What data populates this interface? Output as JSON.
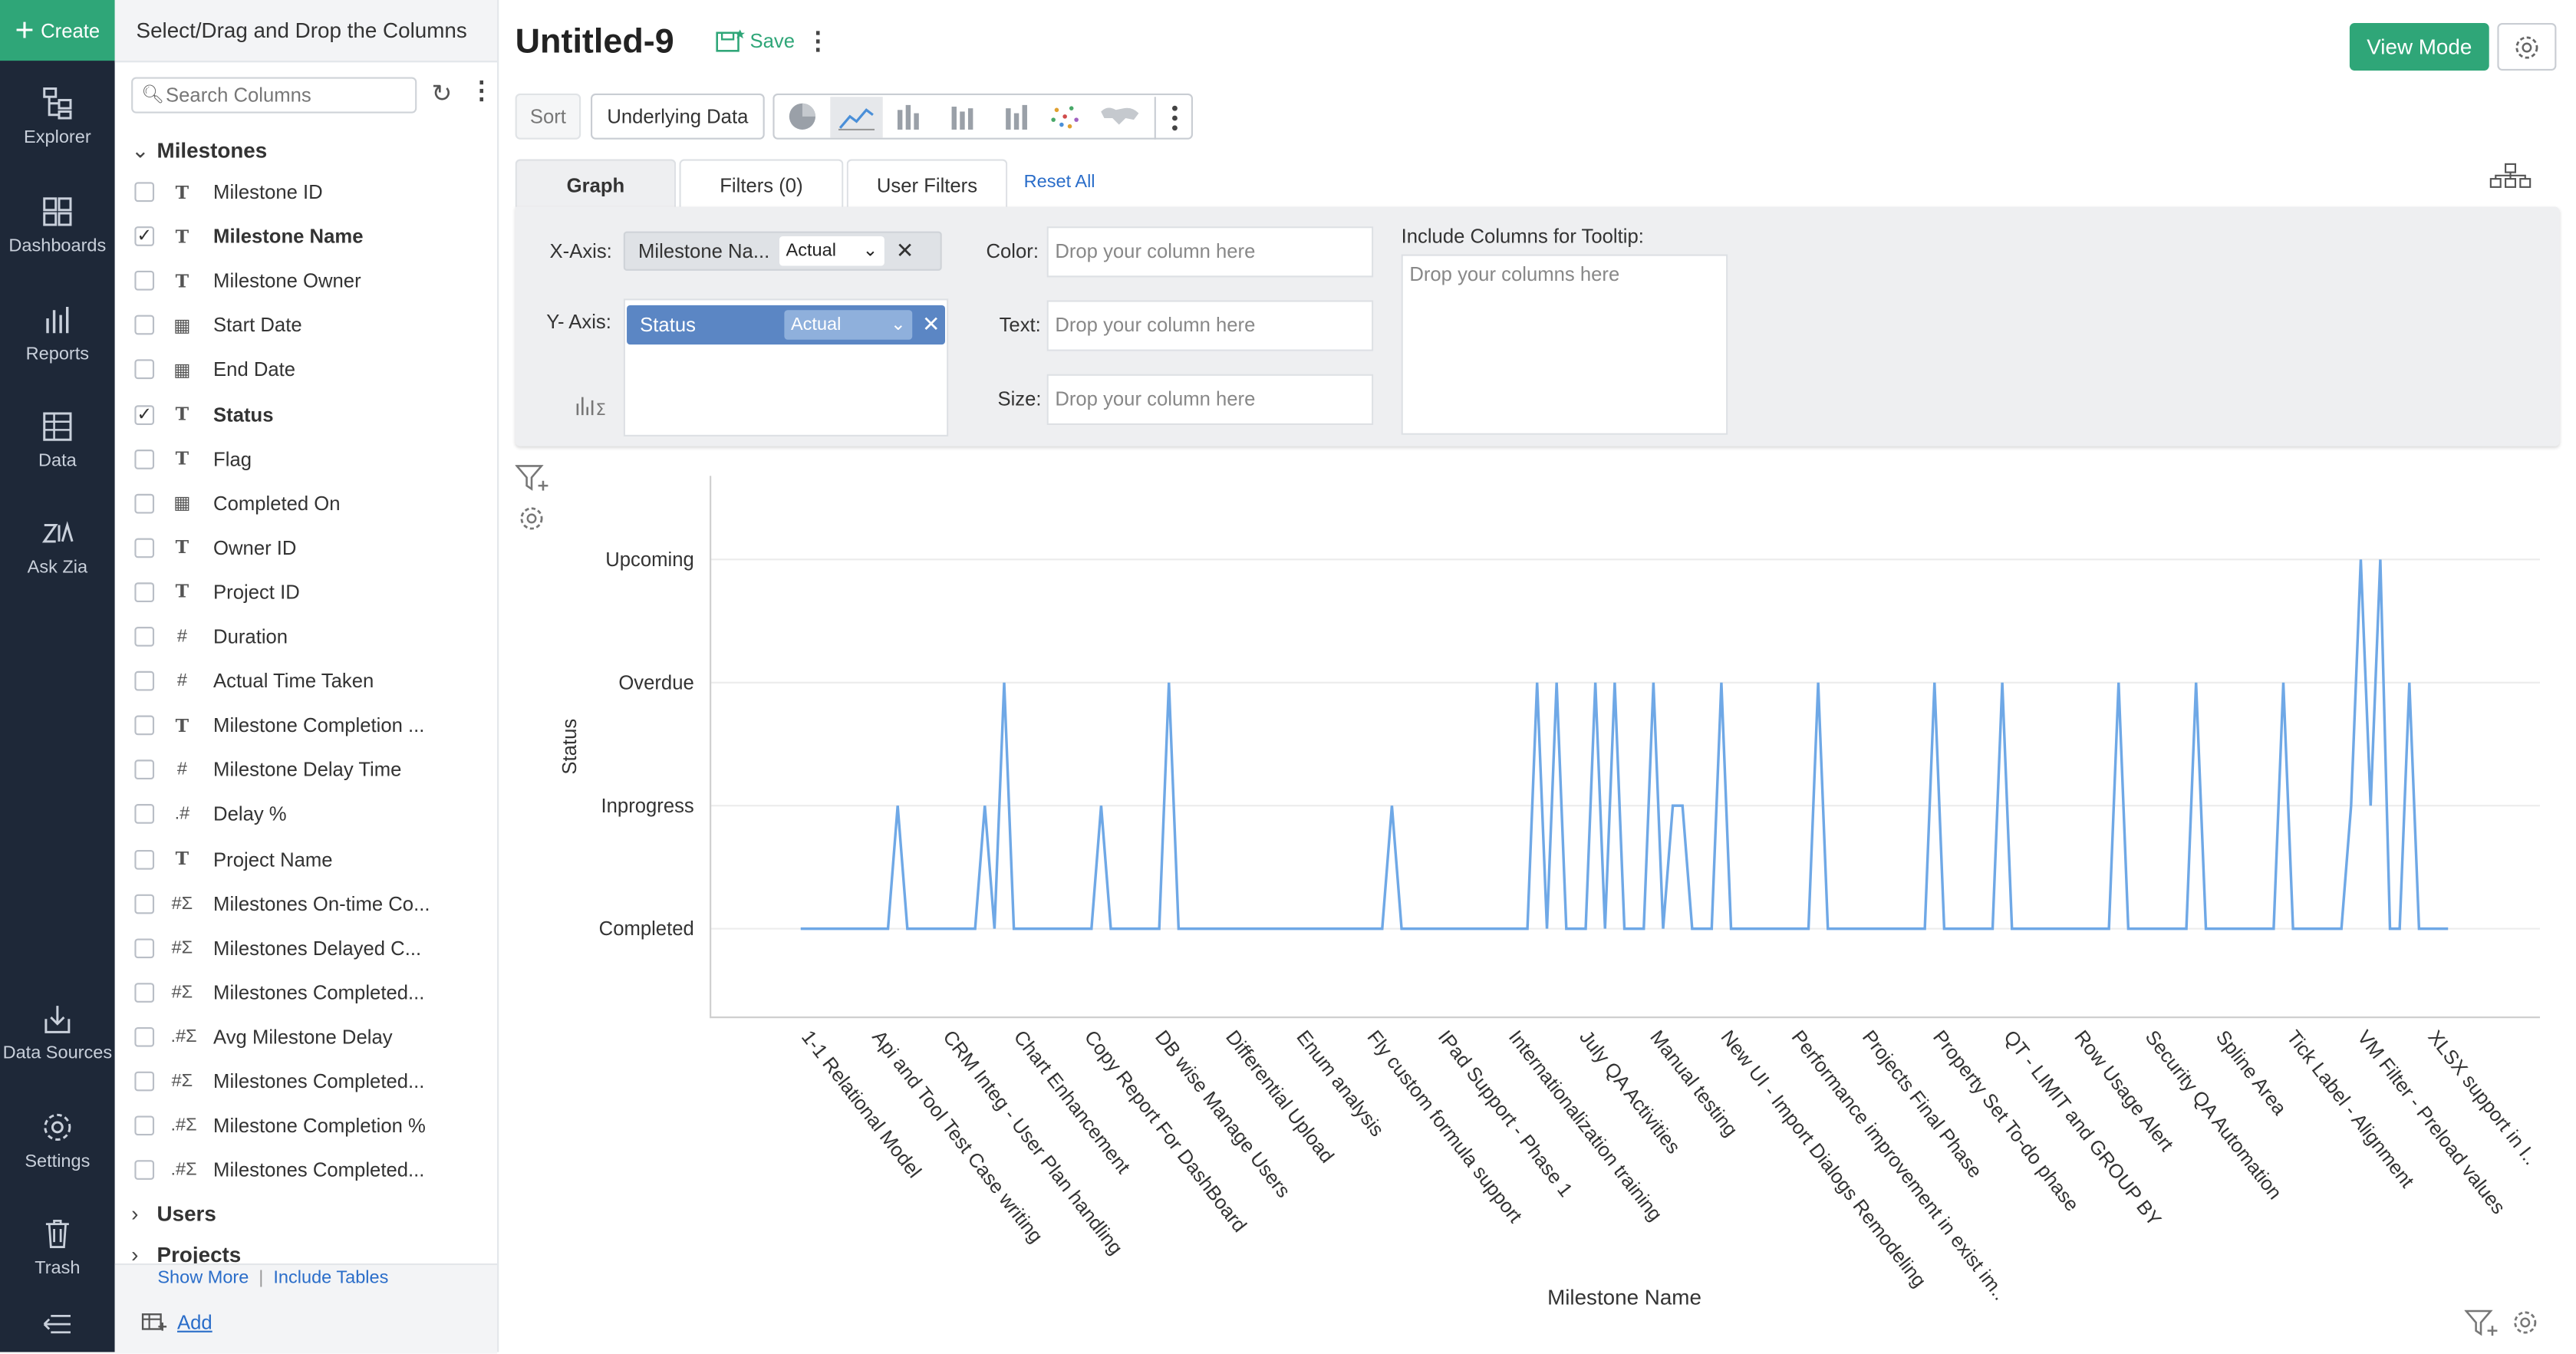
{
  "nav": {
    "create": "Create",
    "items": [
      {
        "label": "Explorer",
        "icon": "explorer-icon"
      },
      {
        "label": "Dashboards",
        "icon": "dashboards-icon"
      },
      {
        "label": "Reports",
        "icon": "reports-icon"
      },
      {
        "label": "Data",
        "icon": "data-icon"
      },
      {
        "label": "Ask Zia",
        "icon": "zia-icon"
      },
      {
        "label": "Data Sources",
        "icon": "data-sources-icon"
      },
      {
        "label": "Settings",
        "icon": "settings-icon"
      },
      {
        "label": "Trash",
        "icon": "trash-icon"
      }
    ]
  },
  "panel": {
    "header": "Select/Drag and Drop the Columns",
    "search_placeholder": "Search Columns",
    "group": "Milestones",
    "columns": [
      {
        "label": "Milestone ID",
        "type": "T",
        "checked": false
      },
      {
        "label": "Milestone Name",
        "type": "T",
        "checked": true
      },
      {
        "label": "Milestone Owner",
        "type": "T",
        "checked": false
      },
      {
        "label": "Start Date",
        "type": "date",
        "checked": false
      },
      {
        "label": "End Date",
        "type": "date",
        "checked": false
      },
      {
        "label": "Status",
        "type": "T",
        "checked": true
      },
      {
        "label": "Flag",
        "type": "T",
        "checked": false
      },
      {
        "label": "Completed On",
        "type": "date",
        "checked": false
      },
      {
        "label": "Owner ID",
        "type": "T",
        "checked": false
      },
      {
        "label": "Project ID",
        "type": "T",
        "checked": false
      },
      {
        "label": "Duration",
        "type": "#",
        "checked": false
      },
      {
        "label": "Actual Time Taken",
        "type": "#",
        "checked": false
      },
      {
        "label": "Milestone Completion ...",
        "type": "T",
        "checked": false
      },
      {
        "label": "Milestone Delay Time",
        "type": "#",
        "checked": false
      },
      {
        "label": "Delay %",
        "type": ".#",
        "checked": false
      },
      {
        "label": "Project Name",
        "type": "T",
        "checked": false
      },
      {
        "label": "Milestones On-time Co...",
        "type": "#Σ",
        "checked": false
      },
      {
        "label": "Milestones Delayed C...",
        "type": "#Σ",
        "checked": false
      },
      {
        "label": "Milestones Completed...",
        "type": "#Σ",
        "checked": false
      },
      {
        "label": "Avg Milestone Delay",
        "type": ".#Σ",
        "checked": false
      },
      {
        "label": "Milestones Completed...",
        "type": "#Σ",
        "checked": false
      },
      {
        "label": "Milestone Completion %",
        "type": ".#Σ",
        "checked": false
      },
      {
        "label": "Milestones Completed...",
        "type": ".#Σ",
        "checked": false
      }
    ],
    "other_groups": [
      "Users",
      "Projects"
    ],
    "show_more": "Show More",
    "include_tables": "Include Tables",
    "add": "Add"
  },
  "header": {
    "title": "Untitled-9",
    "save": "Save",
    "view_mode": "View Mode"
  },
  "toolbar": {
    "sort": "Sort",
    "underlying_data": "Underlying Data"
  },
  "tabs": [
    {
      "label": "Graph",
      "active": true
    },
    {
      "label": "Filters (0)",
      "active": false
    },
    {
      "label": "User Filters",
      "active": false
    }
  ],
  "reset_all": "Reset All",
  "config": {
    "x_axis_label": "X-Axis:",
    "x_axis_column": "Milestone Na...",
    "x_axis_agg": "Actual",
    "y_axis_label": "Y- Axis:",
    "y_axis_column": "Status",
    "y_axis_agg": "Actual",
    "color_label": "Color:",
    "text_label": "Text:",
    "size_label": "Size:",
    "drop_column": "Drop your column here",
    "tooltip_label": "Include Columns for Tooltip:",
    "drop_columns": "Drop your columns here"
  },
  "chart_data": {
    "type": "line",
    "xlabel": "Milestone Name",
    "ylabel": "Status",
    "y_categories": [
      "Completed",
      "Inprogress",
      "Overdue",
      "Upcoming"
    ],
    "x_tick_labels": [
      "1-1 Relational Model",
      "Api and Tool Test Case writing",
      "CRM Integ - User Plan handling",
      "Chart Enhancement",
      "Copy Report For DashBoard",
      "DB wise Manage Users",
      "Differential Upload",
      "Enum analysis",
      "Fly custom formula support",
      "IPad Support - Phase 1",
      "Internationalization training",
      "July QA Activities",
      "Manual testing",
      "New UI - Import Dialogs Remodeling",
      "Performance improvement in exist im..",
      "Projects Final Phase",
      "Property Set To-do phase",
      "QT - LIMIT and GROUP BY",
      "Row Usage Alert",
      "Security QA Automation",
      "Spline Area",
      "Tick Label - Alignment",
      "VM Filter - Preload values",
      "XLSX support in I.."
    ],
    "point_count": 171,
    "spikes": [
      {
        "index": 10,
        "status": "Inprogress"
      },
      {
        "index": 19,
        "status": "Inprogress"
      },
      {
        "index": 21,
        "status": "Overdue"
      },
      {
        "index": 31,
        "status": "Inprogress"
      },
      {
        "index": 38,
        "status": "Overdue"
      },
      {
        "index": 61,
        "status": "Inprogress"
      },
      {
        "index": 76,
        "status": "Overdue"
      },
      {
        "index": 78,
        "status": "Overdue"
      },
      {
        "index": 82,
        "status": "Overdue"
      },
      {
        "index": 84,
        "status": "Overdue"
      },
      {
        "index": 88,
        "status": "Overdue"
      },
      {
        "index": 90,
        "status": "Inprogress"
      },
      {
        "index": 91,
        "status": "Inprogress"
      },
      {
        "index": 95,
        "status": "Overdue"
      },
      {
        "index": 105,
        "status": "Overdue"
      },
      {
        "index": 117,
        "status": "Overdue"
      },
      {
        "index": 124,
        "status": "Overdue"
      },
      {
        "index": 136,
        "status": "Overdue"
      },
      {
        "index": 144,
        "status": "Overdue"
      },
      {
        "index": 153,
        "status": "Overdue"
      },
      {
        "index": 160,
        "status": "Inprogress"
      },
      {
        "index": 161,
        "status": "Upcoming"
      },
      {
        "index": 162,
        "status": "Inprogress"
      },
      {
        "index": 163,
        "status": "Upcoming"
      },
      {
        "index": 166,
        "status": "Overdue"
      }
    ],
    "default_status": "Completed",
    "line_color": "#6fa8e6",
    "grid": true
  }
}
